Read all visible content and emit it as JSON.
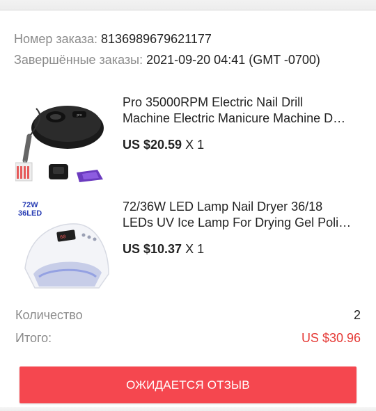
{
  "order": {
    "number_label": "Номер заказа:",
    "number_value": "8136989679621177",
    "completed_label": "Завершённые заказы:",
    "completed_value": "2021-09-20 04:41 (GMT -0700)"
  },
  "products": [
    {
      "title_line1": "Pro 35000RPM Electric Nail Drill",
      "title_line2": "Machine Electric Manicure Machine D…",
      "price": "US $20.59",
      "qty": "X 1",
      "image_icon": "nail-drill-icon"
    },
    {
      "title_line1": "72/36W LED Lamp Nail Dryer 36/18",
      "title_line2": "LEDs UV Ice Lamp For Drying Gel Poli…",
      "price": "US $10.37",
      "qty": "X 1",
      "image_icon": "nail-lamp-icon",
      "image_text_1": "72W",
      "image_text_2": "36LED"
    }
  ],
  "summary": {
    "quantity_label": "Количество",
    "quantity_value": "2",
    "total_label": "Итого:",
    "total_value": "US $30.96"
  },
  "cta": {
    "label": "ОЖИДАЕТСЯ ОТЗЫВ"
  },
  "colors": {
    "accent": "#f5474f",
    "total": "#e53935",
    "muted": "#8a8a8a"
  }
}
